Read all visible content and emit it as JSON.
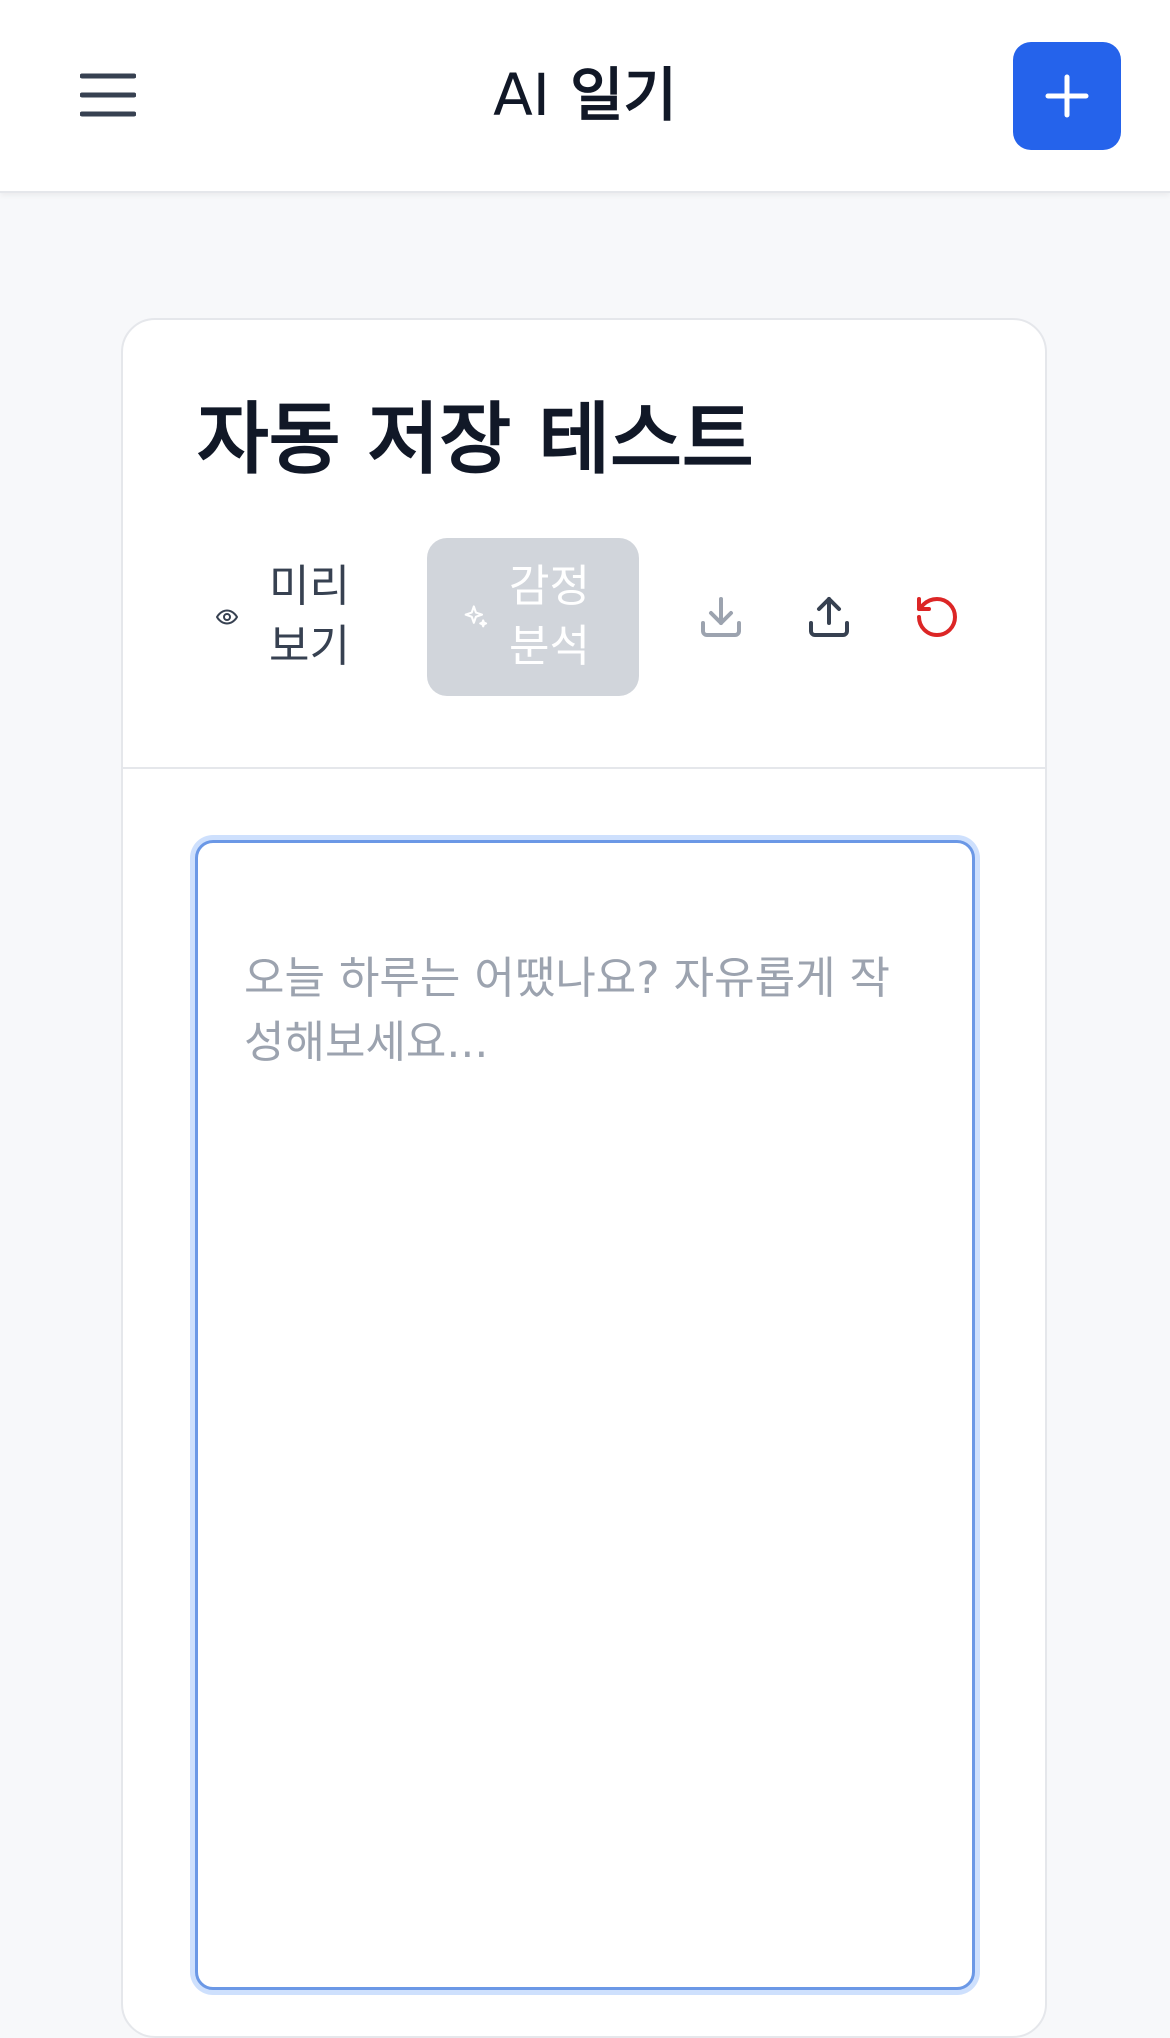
{
  "header": {
    "menu_icon": "menu-icon",
    "title_prefix": "AI",
    "title_main": "일기",
    "add_icon": "plus-icon",
    "accent_color": "#2563eb"
  },
  "entry": {
    "title": "자동 저장 테스트",
    "toolbar": {
      "preview_label": "미리보기",
      "preview_icon": "eye-icon",
      "emotion_label": "감정분석",
      "emotion_icon": "sparkle-icon",
      "emotion_disabled": true,
      "download_icon": "download-icon",
      "upload_icon": "upload-icon",
      "reset_icon": "rotate-ccw-icon",
      "reset_color": "#dc2626"
    },
    "editor": {
      "value": "",
      "placeholder": "오늘 하루는 어땠나요? 자유롭게 작성해보세요..."
    }
  }
}
